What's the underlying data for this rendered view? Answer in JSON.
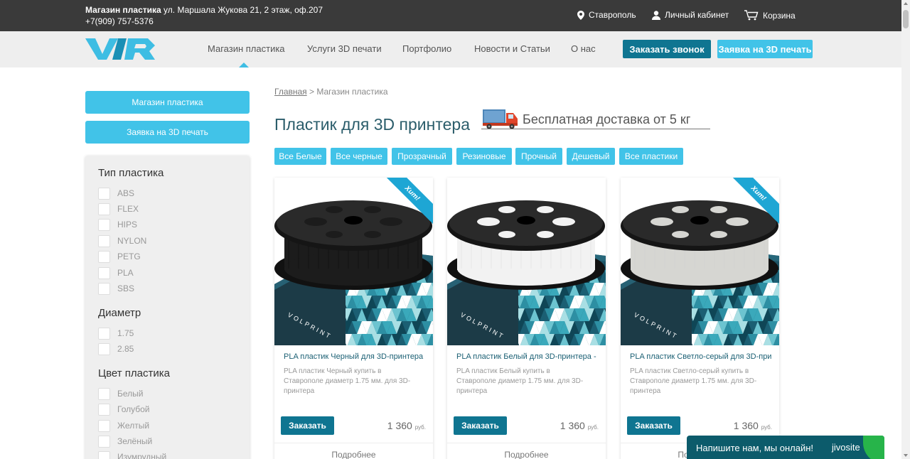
{
  "topbar": {
    "store_name": "Магазин пластика",
    "address": " ул. Маршала Жукова 21, 2 этаж, оф.207",
    "phone": "+7(909) 757-5376",
    "city": "Ставрополь",
    "account": "Личный кабинет",
    "cart": "Корзина"
  },
  "nav": {
    "items": [
      "Магазин пластика",
      "Услуги 3D печати",
      "Портфолио",
      "Новости и Статьи",
      "О нас"
    ],
    "call_button": "Заказать звонок",
    "order_button": "Заявка на 3D печать"
  },
  "sidebar": {
    "btn_shop": "Магазин пластика",
    "btn_order": "Заявка на 3D печать",
    "groups": [
      {
        "title": "Тип пластика",
        "options": [
          "ABS",
          "FLEX",
          "HIPS",
          "NYLON",
          "PETG",
          "PLA",
          "SBS"
        ]
      },
      {
        "title": "Диаметр",
        "options": [
          "1.75",
          "2.85"
        ]
      },
      {
        "title": "Цвет пластика",
        "options": [
          "Белый",
          "Голубой",
          "Желтый",
          "Зелёный",
          "Изумрудный"
        ]
      }
    ]
  },
  "breadcrumb": {
    "home": "Главная",
    "sep": " > ",
    "current": "Магазин пластика"
  },
  "page_title": "Пластик для 3D принтера",
  "delivery_banner": "Бесплатная доставка от 5 кг",
  "tags": [
    "Все Белые",
    "Все черные",
    "Прозрачный",
    "Резиновые",
    "Прочный",
    "Дешевый",
    "Все пластики"
  ],
  "products": [
    {
      "name": "PLA пластик Черный для 3D-принтера ...",
      "desc": "PLA пластик Черный купить в Ставрополе диаметр 1.75 мм. для 3D-принтера",
      "price": "1 360",
      "currency": "руб.",
      "order": "Заказать",
      "more": "Подробнее",
      "badge": "Хит!",
      "filament_color": "#1c1c1c"
    },
    {
      "name": "PLA пластик Белый для 3D-принтера - ...",
      "desc": "PLA пластик Белый купить в Ставрополе диаметр 1.75 мм. для 3D-принтера",
      "price": "1 360",
      "currency": "руб.",
      "order": "Заказать",
      "more": "Подробнее",
      "badge": "",
      "filament_color": "#f2f2f2"
    },
    {
      "name": "PLA пластик Светло-серый для 3D-при...",
      "desc": "PLA пластик Светло-серый купить в Ставрополе диаметр 1.75 мм. для 3D-принтера",
      "price": "1 360",
      "currency": "руб.",
      "order": "Заказать",
      "more": "Подробнее",
      "badge": "Хит!",
      "filament_color": "#d6d6d2"
    }
  ],
  "spool_brand": "VOLPRINT",
  "chat": {
    "message": "Напишите нам, мы онлайн!",
    "brand": "jivosite"
  },
  "colors": {
    "accent": "#41c3e8",
    "dark_accent": "#0f7591",
    "title": "#2b5d6b",
    "topbar": "#3a3a3a"
  }
}
